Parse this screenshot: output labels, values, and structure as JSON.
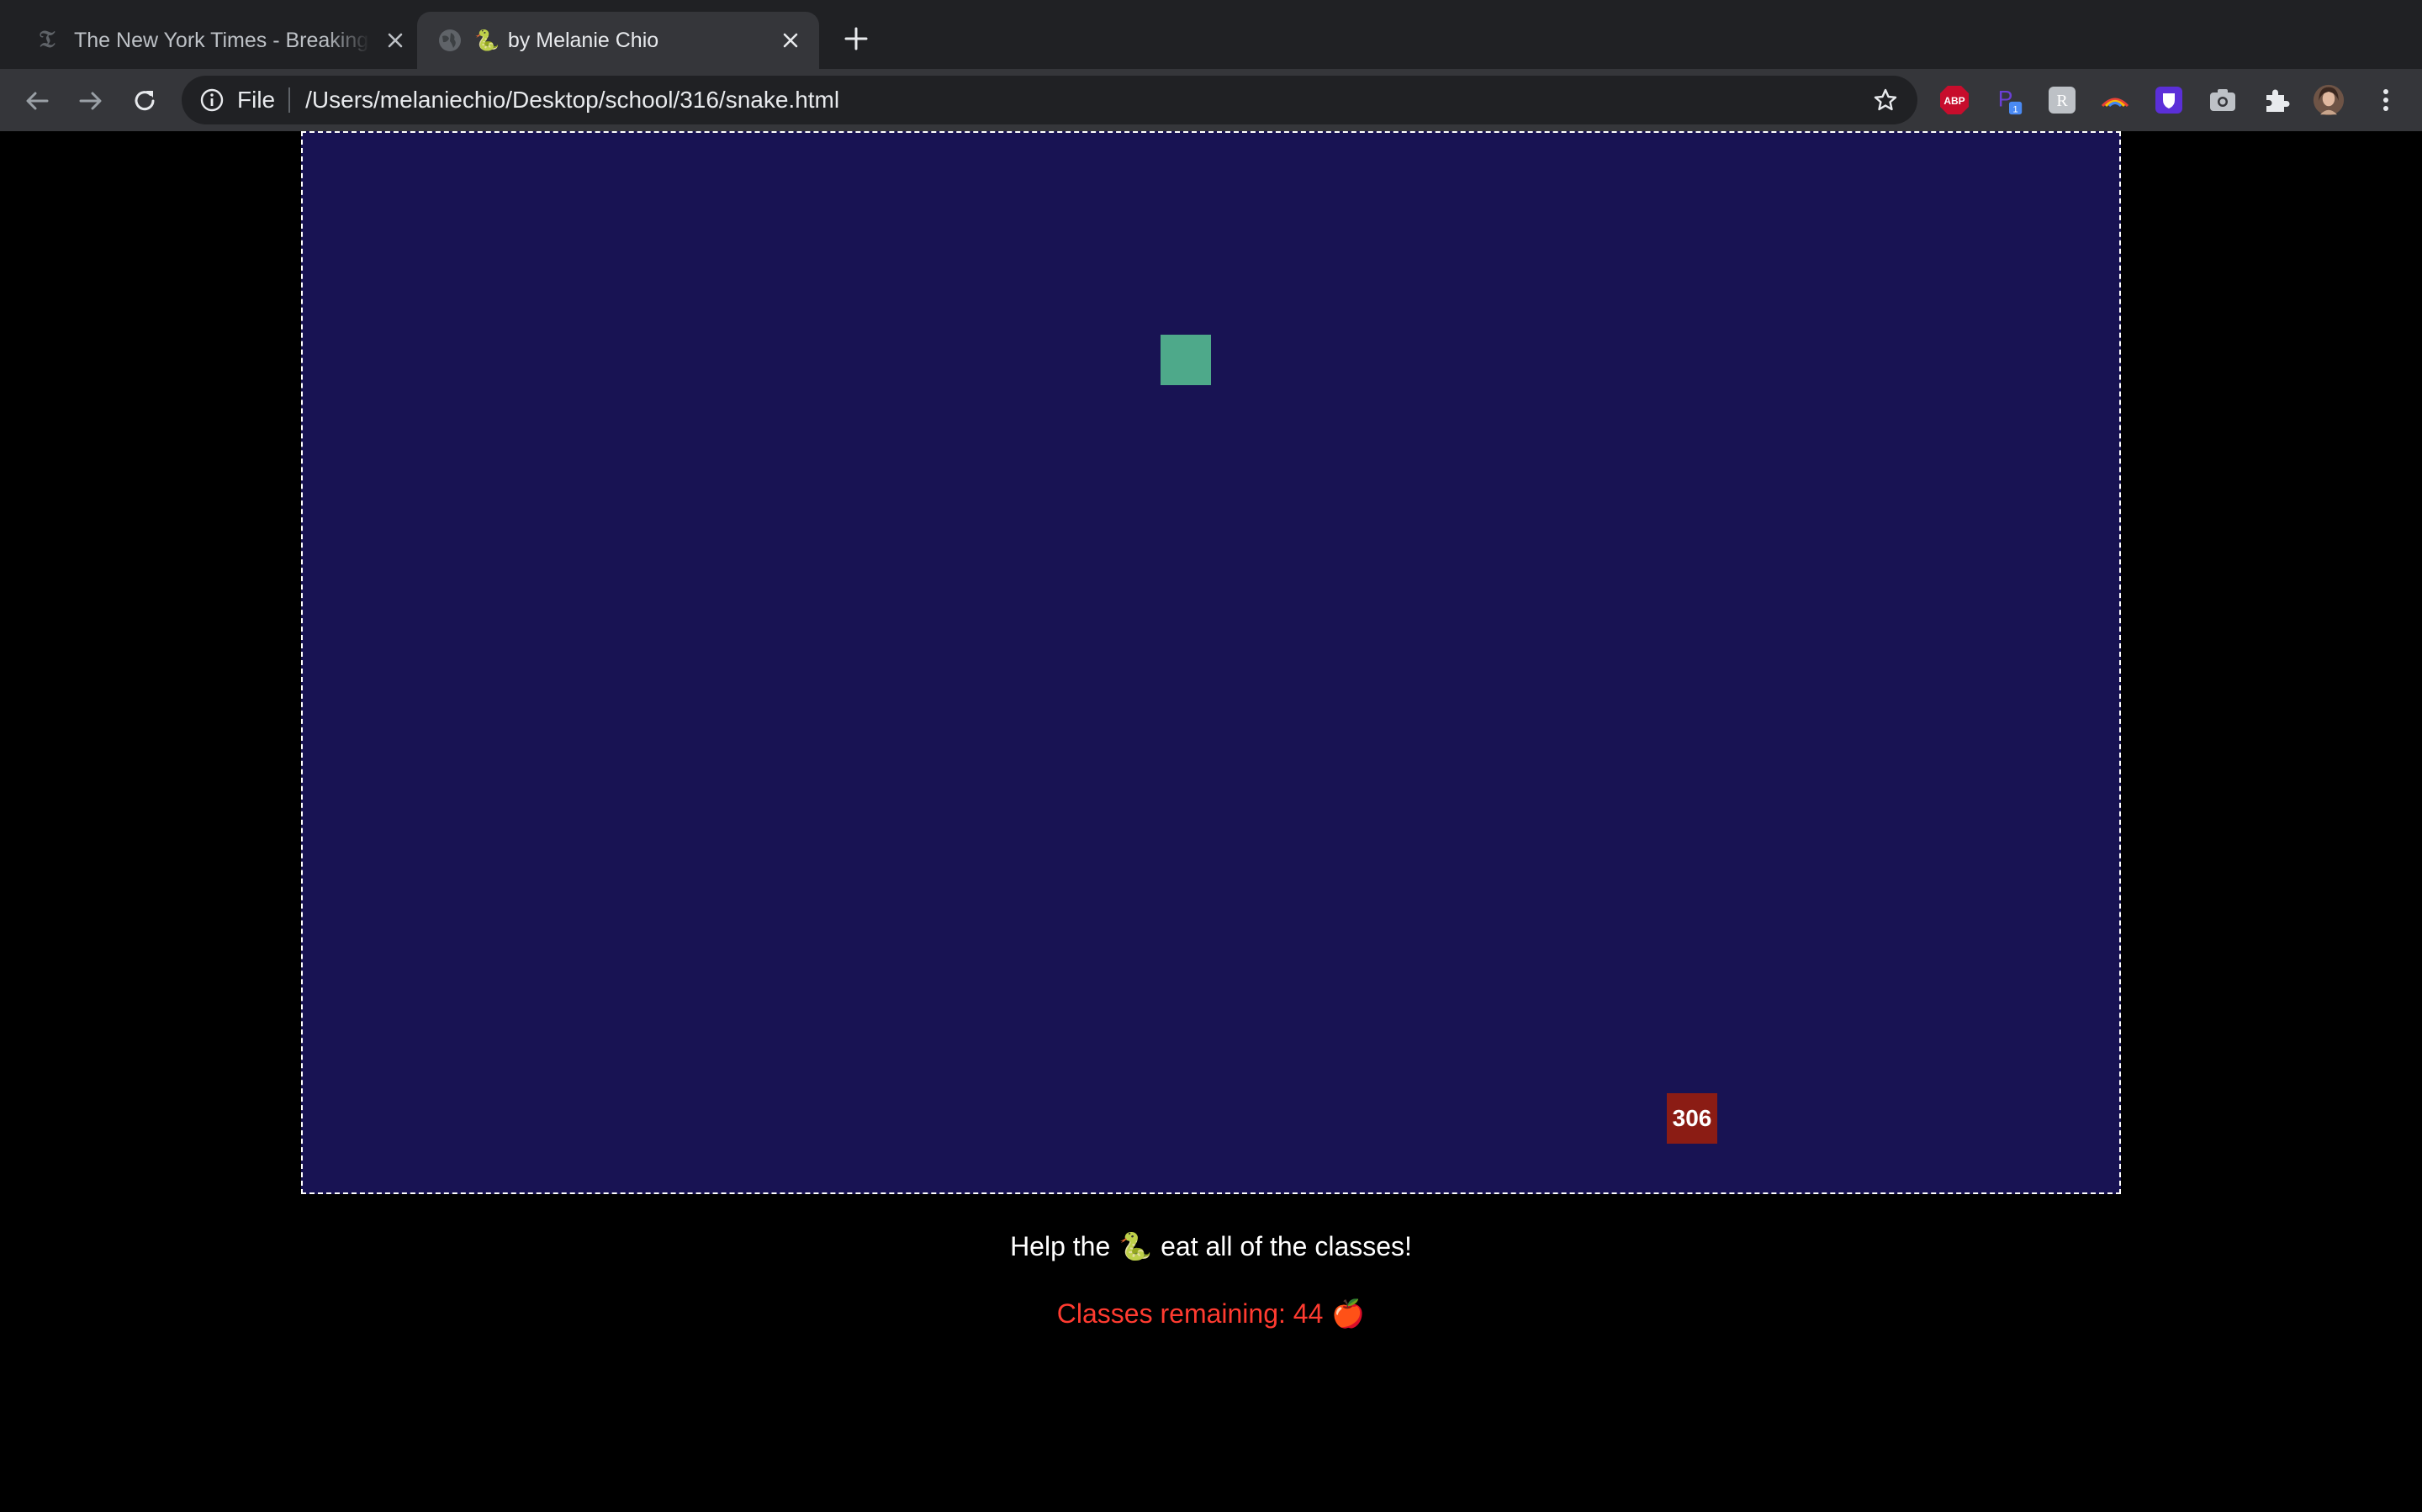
{
  "browser": {
    "tabs": [
      {
        "title": "The New York Times - Breaking",
        "favicon": "nyt-logo-icon",
        "active": false
      },
      {
        "title": "by Melanie Chio",
        "emoji": "🐍",
        "favicon": "globe-icon",
        "active": true
      }
    ],
    "new_tab": "plus-icon",
    "omnibox": {
      "scheme": "File",
      "url": "/Users/melaniechio/Desktop/school/316/snake.html"
    },
    "extensions": [
      {
        "name": "adblock-plus-icon",
        "label": "ABP",
        "color": "#c70d2c"
      },
      {
        "name": "extension-p-icon",
        "label": "P",
        "badge": "1",
        "color": "#6b3fd6"
      },
      {
        "name": "extension-r-icon",
        "label": "R"
      },
      {
        "name": "rainbow-extension-icon"
      },
      {
        "name": "extension-shield-icon",
        "color": "#5b2fd8"
      },
      {
        "name": "camera-icon"
      },
      {
        "name": "puzzle-icon"
      },
      {
        "name": "profile-avatar"
      },
      {
        "name": "kebab-menu-icon"
      }
    ]
  },
  "game": {
    "board_color": "#181353",
    "snake_color": "#4ea98a",
    "food": {
      "label": "306",
      "color": "#8b1c14"
    },
    "instructions_before": "Help the",
    "snake_emoji": "🐍",
    "instructions_after": "eat all of the classes!",
    "remaining_label": "Classes remaining: 44",
    "apple_emoji": "🍎",
    "remaining_color": "#ff3b30"
  }
}
